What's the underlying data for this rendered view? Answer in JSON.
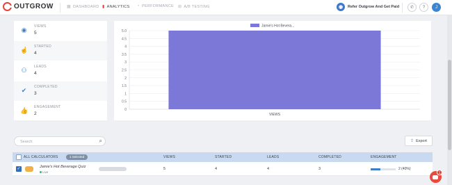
{
  "nav": {
    "logo": "OUTGROW",
    "items": [
      {
        "label": "DASHBOARD",
        "icon": "grid-icon",
        "active": false
      },
      {
        "label": "ANALYTICS",
        "icon": "bar-chart-icon",
        "active": true
      },
      {
        "label": "PERFORMANCE",
        "icon": "gauge-icon",
        "active": false
      },
      {
        "label": "A/B TESTING",
        "icon": "ab-test-icon",
        "active": false
      }
    ],
    "refer": "Refer Outgrow And Get Paid",
    "phone": "✆",
    "help": "?",
    "avatar": "J"
  },
  "metrics": [
    {
      "label": "VIEWS",
      "value": "5",
      "icon": "eye-icon"
    },
    {
      "label": "STARTED",
      "value": "4",
      "icon": "hand-pointer-icon"
    },
    {
      "label": "LEADS",
      "value": "4",
      "icon": "users-icon"
    },
    {
      "label": "COMPLETED",
      "value": "3",
      "icon": "double-check-icon"
    },
    {
      "label": "ENGAGEMENT",
      "value": "2",
      "icon": "thumbs-up-icon"
    }
  ],
  "chart_data": {
    "type": "bar",
    "categories": [
      "VIEWS"
    ],
    "series": [
      {
        "name": "Jamie's Hot Bevera...",
        "values": [
          5
        ],
        "color": "#7b78d8"
      }
    ],
    "ylim": [
      0,
      5
    ],
    "yticks": [
      "0",
      "0.5",
      "1",
      "1.5",
      "2",
      "2.5",
      "3",
      "3.5",
      "4",
      "4.5",
      "5.0"
    ],
    "legend": "top-center",
    "grid": true
  },
  "search": {
    "placeholder": "Search"
  },
  "export_label": "Export",
  "table": {
    "headers": {
      "all": "ALL CALCULATORS",
      "selected": "1 Selected",
      "views": "VIEWS",
      "started": "STARTED",
      "leads": "LEADS",
      "completed": "COMPLETED",
      "engagement": "ENGAGEMENT"
    },
    "rows": [
      {
        "name": "Jamie's Hot Beverage Quiz",
        "status": "Live",
        "views": "5",
        "started": "4",
        "leads": "4",
        "completed": "3",
        "engagement": "2 (40%)",
        "engagement_fraction": 0.4
      }
    ]
  },
  "chat_badge": "1",
  "colors": {
    "brand": "#e5433d",
    "accent": "#3c7fc7",
    "bar": "#7b78d8",
    "table_header": "#c9daf0"
  }
}
